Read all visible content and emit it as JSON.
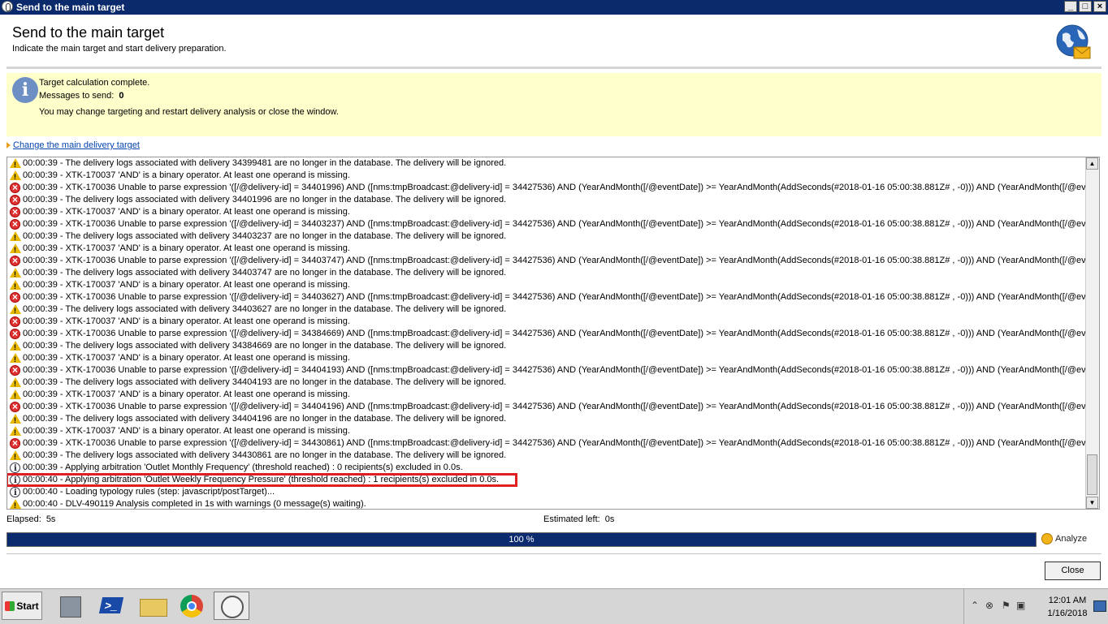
{
  "window": {
    "title": "Send to the main target"
  },
  "header": {
    "title": "Send to the main target",
    "subtitle": "Indicate the main target and start delivery preparation."
  },
  "info": {
    "line1": "Target calculation complete.",
    "messages_label": "Messages to send:",
    "messages_value": "0",
    "line3": "You may change targeting and restart delivery analysis or close the window."
  },
  "link": {
    "label": "Change the main delivery target"
  },
  "log": [
    {
      "type": "warn",
      "text": "00:00:39 - The delivery logs associated with delivery 34399481 are no longer in the database. The delivery will be ignored."
    },
    {
      "type": "warn",
      "text": "00:00:39 - XTK-170037 'AND' is a binary operator. At least one operand is missing."
    },
    {
      "type": "err",
      "text": "00:00:39 - XTK-170036 Unable to parse expression '([/@delivery-id] = 34401996) AND ([nms:tmpBroadcast:@delivery-id] = 34427536) AND (YearAndMonth([/@eventDate]) >= YearAndMonth(AddSeconds(#2018-01-16 05:00:38.881Z# , -0))) AND (YearAndMonth([/@eventDate"
    },
    {
      "type": "err",
      "text": "00:00:39 - The delivery logs associated with delivery 34401996 are no longer in the database. The delivery will be ignored."
    },
    {
      "type": "err",
      "text": "00:00:39 - XTK-170037 'AND' is a binary operator. At least one operand is missing."
    },
    {
      "type": "err",
      "text": "00:00:39 - XTK-170036 Unable to parse expression '([/@delivery-id] = 34403237) AND ([nms:tmpBroadcast:@delivery-id] = 34427536) AND (YearAndMonth([/@eventDate]) >= YearAndMonth(AddSeconds(#2018-01-16 05:00:38.881Z# , -0))) AND (YearAndMonth([/@eventDate"
    },
    {
      "type": "warn",
      "text": "00:00:39 - The delivery logs associated with delivery 34403237 are no longer in the database. The delivery will be ignored."
    },
    {
      "type": "warn",
      "text": "00:00:39 - XTK-170037 'AND' is a binary operator. At least one operand is missing."
    },
    {
      "type": "err",
      "text": "00:00:39 - XTK-170036 Unable to parse expression '([/@delivery-id] = 34403747) AND ([nms:tmpBroadcast:@delivery-id] = 34427536) AND (YearAndMonth([/@eventDate]) >= YearAndMonth(AddSeconds(#2018-01-16 05:00:38.881Z# , -0))) AND (YearAndMonth([/@eventDate"
    },
    {
      "type": "warn",
      "text": "00:00:39 - The delivery logs associated with delivery 34403747 are no longer in the database. The delivery will be ignored."
    },
    {
      "type": "warn",
      "text": "00:00:39 - XTK-170037 'AND' is a binary operator. At least one operand is missing."
    },
    {
      "type": "err",
      "text": "00:00:39 - XTK-170036 Unable to parse expression '([/@delivery-id] = 34403627) AND ([nms:tmpBroadcast:@delivery-id] = 34427536) AND (YearAndMonth([/@eventDate]) >= YearAndMonth(AddSeconds(#2018-01-16 05:00:38.881Z# , -0))) AND (YearAndMonth([/@eventDate"
    },
    {
      "type": "warn",
      "text": "00:00:39 - The delivery logs associated with delivery 34403627 are no longer in the database. The delivery will be ignored."
    },
    {
      "type": "err",
      "text": "00:00:39 - XTK-170037 'AND' is a binary operator. At least one operand is missing."
    },
    {
      "type": "err",
      "text": "00:00:39 - XTK-170036 Unable to parse expression '([/@delivery-id] = 34384669) AND ([nms:tmpBroadcast:@delivery-id] = 34427536) AND (YearAndMonth([/@eventDate]) >= YearAndMonth(AddSeconds(#2018-01-16 05:00:38.881Z# , -0))) AND (YearAndMonth([/@eventDate"
    },
    {
      "type": "warn",
      "text": "00:00:39 - The delivery logs associated with delivery 34384669 are no longer in the database. The delivery will be ignored."
    },
    {
      "type": "warn",
      "text": "00:00:39 - XTK-170037 'AND' is a binary operator. At least one operand is missing."
    },
    {
      "type": "err",
      "text": "00:00:39 - XTK-170036 Unable to parse expression '([/@delivery-id] = 34404193) AND ([nms:tmpBroadcast:@delivery-id] = 34427536) AND (YearAndMonth([/@eventDate]) >= YearAndMonth(AddSeconds(#2018-01-16 05:00:38.881Z# , -0))) AND (YearAndMonth([/@eventDate"
    },
    {
      "type": "warn",
      "text": "00:00:39 - The delivery logs associated with delivery 34404193 are no longer in the database. The delivery will be ignored."
    },
    {
      "type": "warn",
      "text": "00:00:39 - XTK-170037 'AND' is a binary operator. At least one operand is missing."
    },
    {
      "type": "err",
      "text": "00:00:39 - XTK-170036 Unable to parse expression '([/@delivery-id] = 34404196) AND ([nms:tmpBroadcast:@delivery-id] = 34427536) AND (YearAndMonth([/@eventDate]) >= YearAndMonth(AddSeconds(#2018-01-16 05:00:38.881Z# , -0))) AND (YearAndMonth([/@eventDate"
    },
    {
      "type": "warn",
      "text": "00:00:39 - The delivery logs associated with delivery 34404196 are no longer in the database. The delivery will be ignored."
    },
    {
      "type": "warn",
      "text": "00:00:39 - XTK-170037 'AND' is a binary operator. At least one operand is missing."
    },
    {
      "type": "err",
      "text": "00:00:39 - XTK-170036 Unable to parse expression '([/@delivery-id] = 34430861) AND ([nms:tmpBroadcast:@delivery-id] = 34427536) AND (YearAndMonth([/@eventDate]) >= YearAndMonth(AddSeconds(#2018-01-16 05:00:38.881Z# , -0))) AND (YearAndMonth([/@eventDate"
    },
    {
      "type": "warn",
      "text": "00:00:39 - The delivery logs associated with delivery 34430861 are no longer in the database. The delivery will be ignored."
    },
    {
      "type": "info",
      "text": "00:00:39 - Applying arbitration 'Outlet Monthly Frequency' (threshold reached) : 0 recipients(s) excluded in 0.0s."
    },
    {
      "type": "info",
      "text": "00:00:40 - Applying arbitration 'Outlet Weekly Frequency Pressure' (threshold reached) : 1 recipients(s) excluded in 0.0s."
    },
    {
      "type": "info",
      "text": "00:00:40 - Loading typology rules (step: javascript/postTarget)..."
    },
    {
      "type": "warn",
      "text": "00:00:40 - DLV-490119 Analysis completed in 1s with warnings (0 message(s) waiting)."
    }
  ],
  "status": {
    "elapsed_label": "Elapsed:",
    "elapsed_value": "5s",
    "estimated_label": "Estimated left:",
    "estimated_value": "0s",
    "progress_text": "100 %",
    "progress_fraction": 1.0
  },
  "buttons": {
    "analyze": "Analyze",
    "close": "Close"
  },
  "taskbar": {
    "start_label": "Start",
    "time": "12:01 AM",
    "date": "1/16/2018"
  },
  "colors": {
    "titlebar": "#0b2a6b",
    "info_bg": "#ffffcc",
    "progress": "#0c2a6e",
    "highlight": "#e02020"
  }
}
